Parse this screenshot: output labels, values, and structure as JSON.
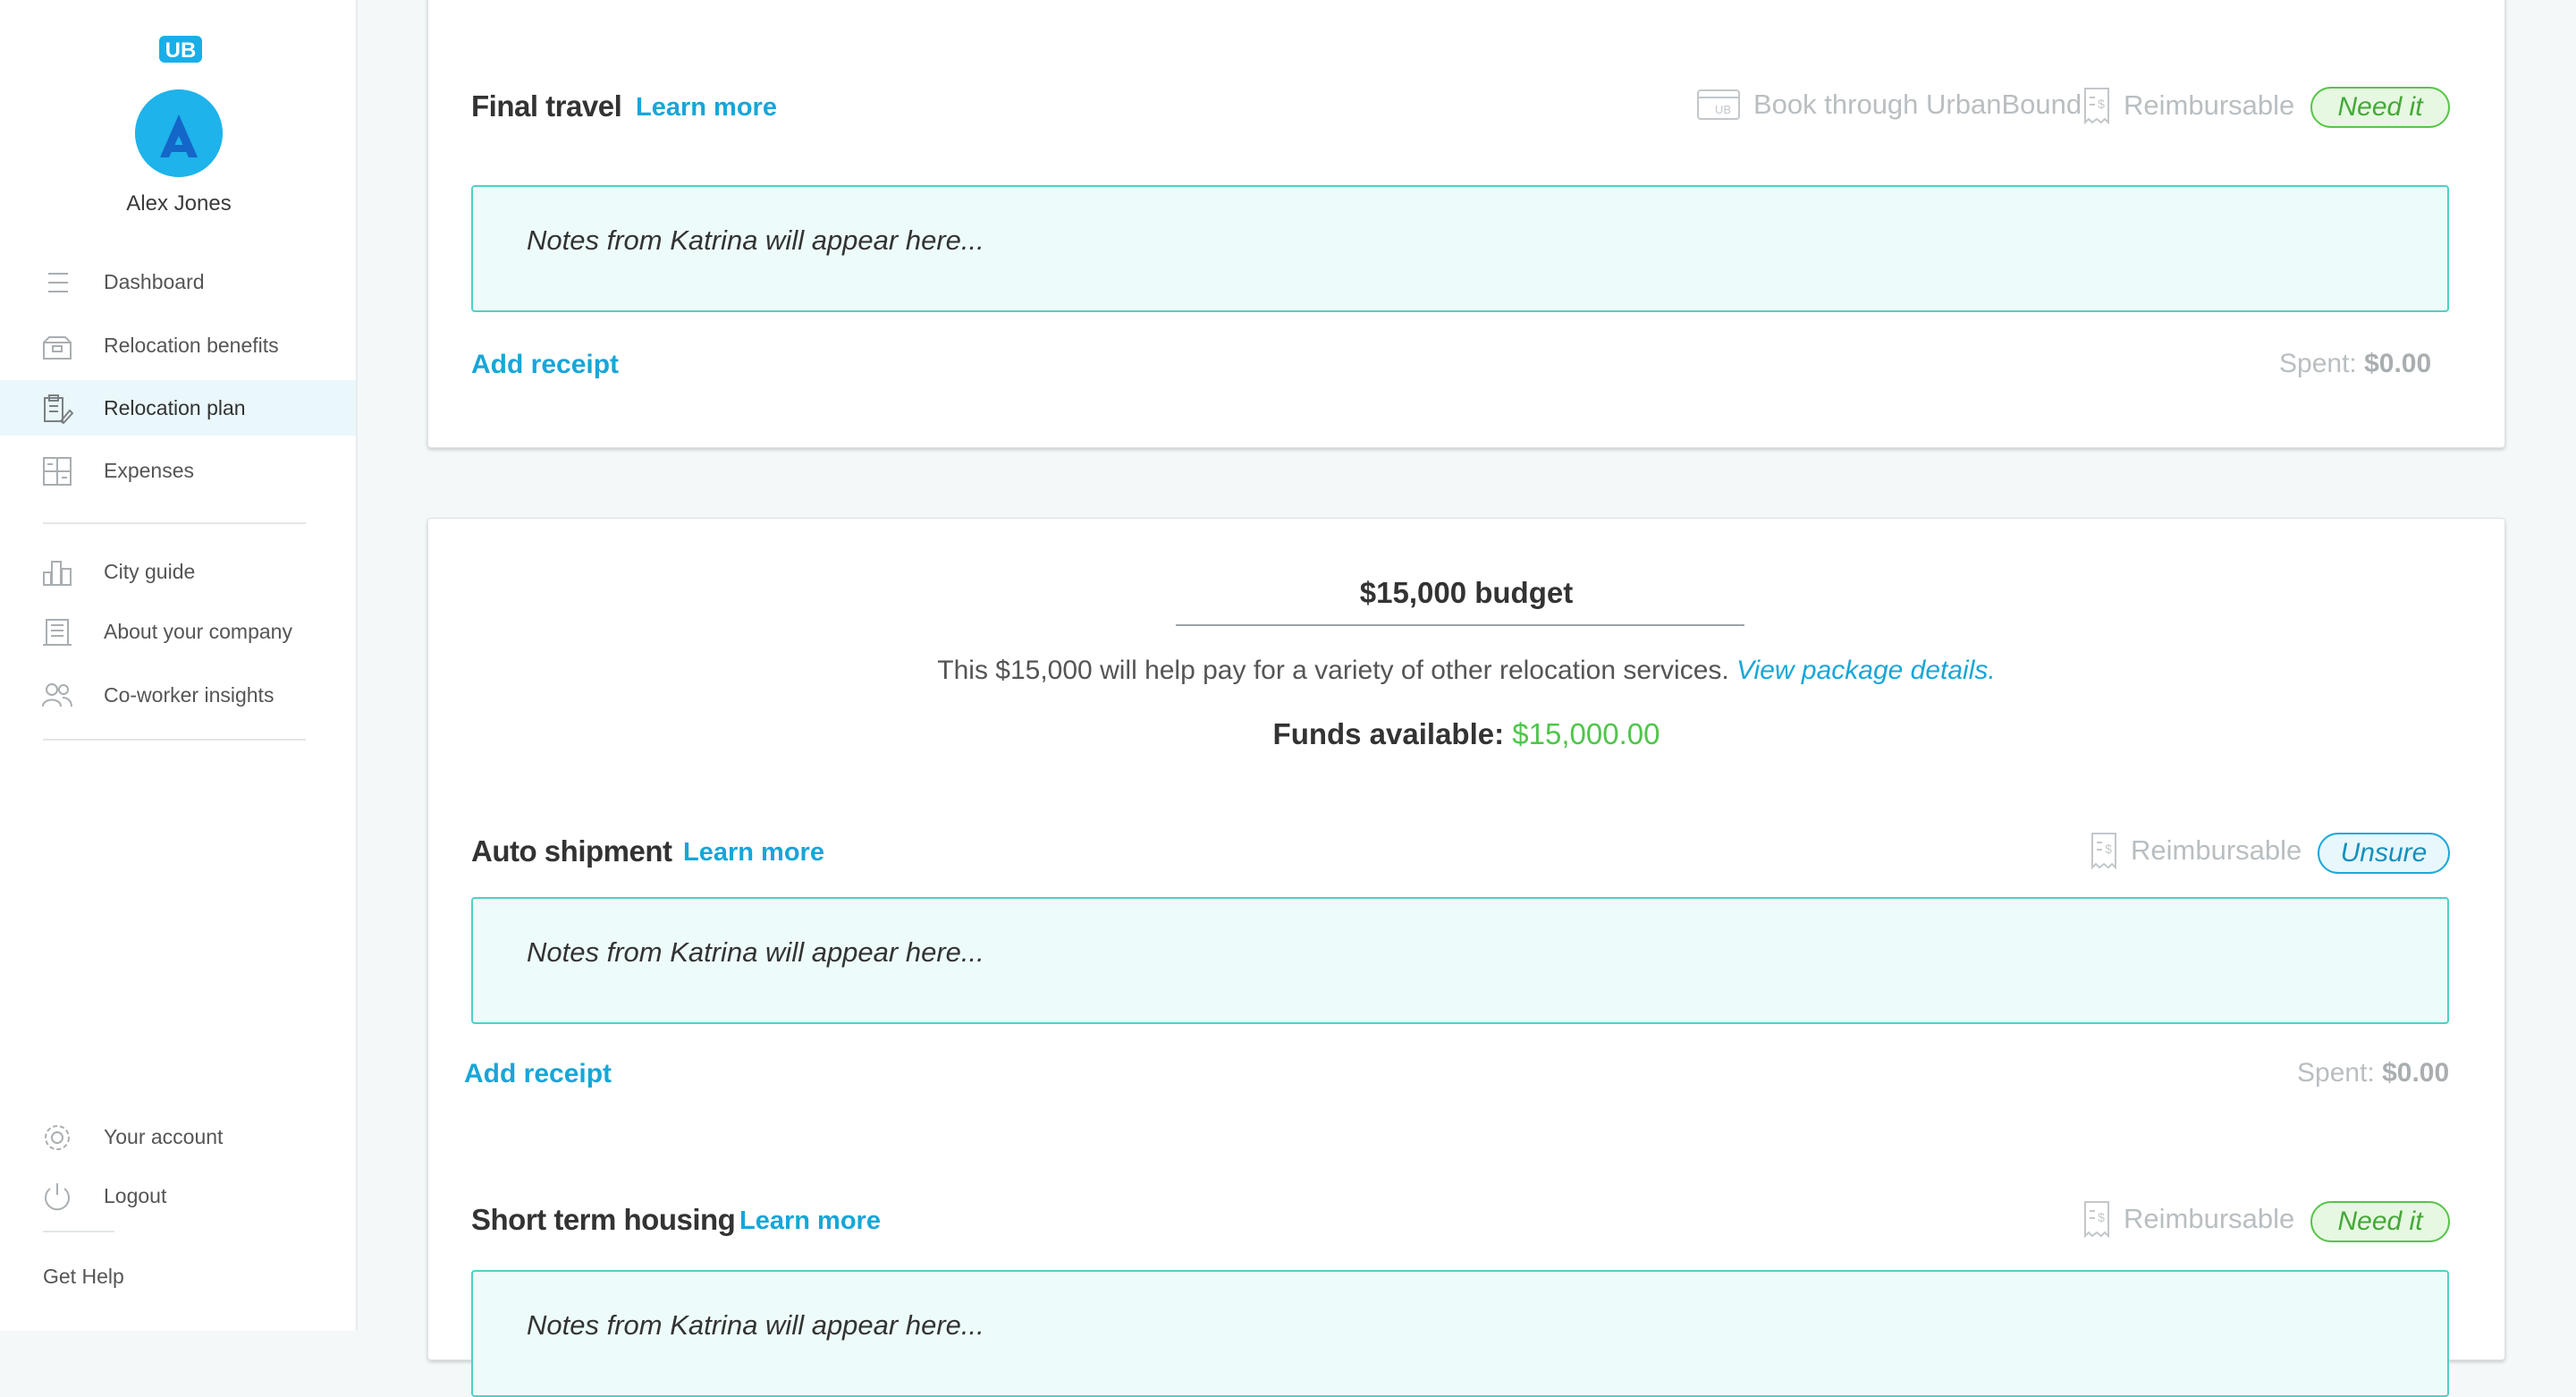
{
  "sidebar": {
    "logo_text": "UB",
    "user_name": "Alex Jones",
    "avatar_letter": "A",
    "nav_main": [
      {
        "label": "Dashboard",
        "icon": "list-icon"
      },
      {
        "label": "Relocation benefits",
        "icon": "gift-box-icon"
      },
      {
        "label": "Relocation plan",
        "icon": "clipboard-pencil-icon",
        "active": true
      },
      {
        "label": "Expenses",
        "icon": "calculator-icon"
      }
    ],
    "nav_secondary": [
      {
        "label": "City guide",
        "icon": "city-icon"
      },
      {
        "label": "About your company",
        "icon": "building-icon"
      },
      {
        "label": "Co-worker insights",
        "icon": "people-icon"
      }
    ],
    "account_label": "Your account",
    "logout_label": "Logout",
    "help_label": "Get Help"
  },
  "final_travel": {
    "title": "Final travel",
    "learn_more": "Learn more",
    "book_label": "Book through UrbanBound",
    "reimbursable_label": "Reimbursable",
    "status": "Need it",
    "notes_placeholder": "Notes from Katrina will appear here...",
    "add_receipt": "Add receipt",
    "spent_label": "Spent:",
    "spent_value": "$0.00"
  },
  "budget": {
    "title": "$15,000 budget",
    "description": "This $15,000 will help pay for a variety of other relocation services.",
    "details_link": "View package details.",
    "funds_label": "Funds available:",
    "funds_value": "$15,000.00"
  },
  "auto_shipment": {
    "title": "Auto shipment",
    "learn_more": "Learn more",
    "reimbursable_label": "Reimbursable",
    "status": "Unsure",
    "notes_placeholder": "Notes from Katrina will appear here...",
    "add_receipt": "Add receipt",
    "spent_label": "Spent:",
    "spent_value": "$0.00"
  },
  "short_term_housing": {
    "title": "Short term housing",
    "learn_more": "Learn more",
    "reimbursable_label": "Reimbursable",
    "status": "Need it",
    "notes_placeholder": "Notes from Katrina will appear here..."
  },
  "colors": {
    "accent": "#17a6d8",
    "success": "#58c54a",
    "notes_bg": "#edfcfa",
    "notes_border": "#4fd1c5"
  }
}
